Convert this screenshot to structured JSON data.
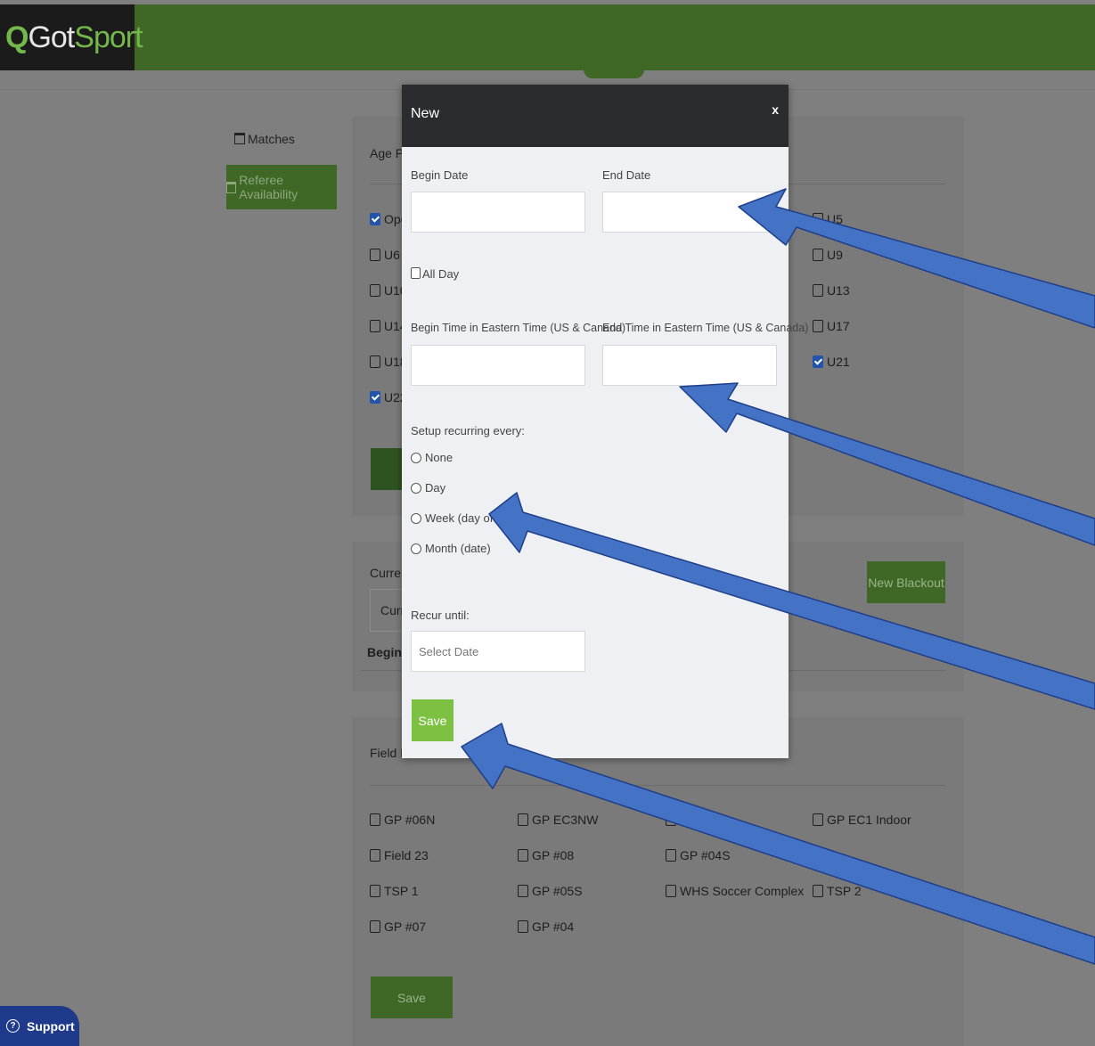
{
  "app": {
    "logo_prefix": "Got",
    "logo_suffix": "Sport",
    "logo_icon": "gotsport-q-icon"
  },
  "nav": {
    "matches_label": "Matches",
    "referee_availability_label": "Referee Availability"
  },
  "background": {
    "age_pref_label": "Age Pre",
    "age_options": [
      {
        "label": "Ope",
        "checked": true
      },
      {
        "label": "U5",
        "checked": false
      },
      {
        "label": "U6",
        "checked": false
      },
      {
        "label": "U9",
        "checked": false
      },
      {
        "label": "U10",
        "checked": false
      },
      {
        "label": "U13",
        "checked": false
      },
      {
        "label": "U14",
        "checked": false
      },
      {
        "label": "U17",
        "checked": false
      },
      {
        "label": "U18",
        "checked": false
      },
      {
        "label": "U21",
        "checked": true
      },
      {
        "label": "U22",
        "checked": true
      }
    ],
    "current_label": "Current",
    "current_input_text": "Curre",
    "begin_col": "Begin",
    "new_blackout_label": "New Blackout",
    "field_pref_label": "Field Pr",
    "fields": [
      {
        "label": "GP #06N"
      },
      {
        "label": "GP EC3NW"
      },
      {
        "label": ""
      },
      {
        "label": "GP EC1 Indoor"
      },
      {
        "label": "Field 23"
      },
      {
        "label": "GP #08"
      },
      {
        "label": "GP #04S"
      },
      {
        "label": "TSP 1"
      },
      {
        "label": "GP #05S"
      },
      {
        "label": "WHS Soccer Complex"
      },
      {
        "label": "TSP 2"
      },
      {
        "label": "GP #07"
      },
      {
        "label": "GP #04"
      }
    ],
    "save_label": "Save"
  },
  "modal": {
    "title": "New",
    "close_label": "x",
    "begin_date_label": "Begin Date",
    "end_date_label": "End Date",
    "begin_date_value": "",
    "end_date_value": "",
    "all_day_label": "All Day",
    "begin_time_label": "Begin Time in Eastern Time (US & Canada)",
    "end_time_label": "End Time in Eastern Time (US & Canada)",
    "begin_time_value": "",
    "end_time_value": "",
    "recurring_label": "Setup recurring every:",
    "recurring_options": [
      "None",
      "Day",
      "Week (day of",
      "Month (date)"
    ],
    "recur_until_label": "Recur until:",
    "recur_until_placeholder": "Select Date",
    "save_label": "Save"
  },
  "support": {
    "label": "Support",
    "icon": "question-circle-icon"
  },
  "colors": {
    "header_green": "#3f6726",
    "modal_header": "#2b2c30",
    "save_green": "#7dc142",
    "annotation_arrow": "#4472c4",
    "support_blue": "#1f3a8a"
  }
}
